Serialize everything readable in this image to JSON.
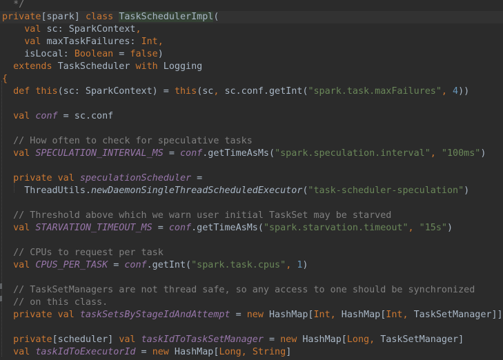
{
  "colors": {
    "background": "#2b2b2b",
    "current_line": "#323232",
    "keyword": "#cc7832",
    "default": "#a9b7c6",
    "string": "#6a8759",
    "comment": "#808080",
    "number": "#6897bb",
    "field": "#9876aa",
    "type_highlight": "#344134"
  },
  "editor": {
    "lines": [
      {
        "tokens": [
          {
            "t": "  */",
            "c": "comment"
          }
        ]
      },
      {
        "current": true,
        "tokens": [
          {
            "t": "private",
            "c": "keyword"
          },
          {
            "t": "[spark] ",
            "c": "default"
          },
          {
            "t": "class",
            "c": "keyword"
          },
          {
            "t": " ",
            "c": "default"
          },
          {
            "t": "TaskSchedulerImpl",
            "c": "default",
            "bg": true
          },
          {
            "t": "(",
            "c": "default"
          }
        ]
      },
      {
        "tokens": [
          {
            "t": "    ",
            "c": "default"
          },
          {
            "t": "val",
            "c": "keyword"
          },
          {
            "t": " sc: SparkContext",
            "c": "default"
          },
          {
            "t": ",",
            "c": "keyword"
          }
        ]
      },
      {
        "tokens": [
          {
            "t": "    ",
            "c": "default"
          },
          {
            "t": "val",
            "c": "keyword"
          },
          {
            "t": " maxTaskFailures: ",
            "c": "default"
          },
          {
            "t": "Int,",
            "c": "keyword"
          }
        ]
      },
      {
        "tokens": [
          {
            "t": "    isLocal: ",
            "c": "default"
          },
          {
            "t": "Boolean",
            "c": "keyword"
          },
          {
            "t": " = ",
            "c": "default"
          },
          {
            "t": "false",
            "c": "keyword"
          },
          {
            "t": ")",
            "c": "default"
          }
        ]
      },
      {
        "tokens": [
          {
            "t": "  ",
            "c": "default"
          },
          {
            "t": "extends",
            "c": "keyword"
          },
          {
            "t": " TaskScheduler ",
            "c": "default"
          },
          {
            "t": "with",
            "c": "keyword"
          },
          {
            "t": " Logging",
            "c": "default"
          }
        ]
      },
      {
        "tokens": [
          {
            "t": "{",
            "c": "keyword"
          }
        ]
      },
      {
        "tokens": [
          {
            "t": "  ",
            "c": "default"
          },
          {
            "t": "def",
            "c": "keyword"
          },
          {
            "t": " ",
            "c": "default"
          },
          {
            "t": "this",
            "c": "keyword"
          },
          {
            "t": "(sc: SparkContext) = ",
            "c": "default"
          },
          {
            "t": "this",
            "c": "keyword"
          },
          {
            "t": "(sc",
            "c": "default"
          },
          {
            "t": ",",
            "c": "keyword"
          },
          {
            "t": " sc.conf.getInt(",
            "c": "default"
          },
          {
            "t": "\"spark.task.maxFailures\"",
            "c": "string"
          },
          {
            "t": ", ",
            "c": "keyword"
          },
          {
            "t": "4",
            "c": "number"
          },
          {
            "t": "))",
            "c": "default"
          }
        ]
      },
      {
        "tokens": []
      },
      {
        "tokens": [
          {
            "t": "  ",
            "c": "default"
          },
          {
            "t": "val",
            "c": "keyword"
          },
          {
            "t": " ",
            "c": "default"
          },
          {
            "t": "conf",
            "c": "field",
            "i": true
          },
          {
            "t": " = sc.conf",
            "c": "default"
          }
        ]
      },
      {
        "tokens": []
      },
      {
        "tokens": [
          {
            "t": "  // How often to check for speculative tasks",
            "c": "comment"
          }
        ]
      },
      {
        "tokens": [
          {
            "t": "  ",
            "c": "default"
          },
          {
            "t": "val",
            "c": "keyword"
          },
          {
            "t": " ",
            "c": "default"
          },
          {
            "t": "SPECULATION_INTERVAL_MS",
            "c": "field",
            "i": true
          },
          {
            "t": " = ",
            "c": "default"
          },
          {
            "t": "conf",
            "c": "field",
            "i": true
          },
          {
            "t": ".getTimeAsMs(",
            "c": "default"
          },
          {
            "t": "\"spark.speculation.interval\"",
            "c": "string"
          },
          {
            "t": ", ",
            "c": "keyword"
          },
          {
            "t": "\"100ms\"",
            "c": "string"
          },
          {
            "t": ")",
            "c": "default"
          }
        ]
      },
      {
        "tokens": []
      },
      {
        "tokens": [
          {
            "t": "  ",
            "c": "default"
          },
          {
            "t": "private val",
            "c": "keyword"
          },
          {
            "t": " ",
            "c": "default"
          },
          {
            "t": "speculationScheduler",
            "c": "field",
            "i": true
          },
          {
            "t": " =",
            "c": "default"
          }
        ]
      },
      {
        "tokens": [
          {
            "t": "    ThreadUtils.",
            "c": "default"
          },
          {
            "t": "newDaemonSingleThreadScheduledExecutor",
            "c": "default",
            "i": true
          },
          {
            "t": "(",
            "c": "default"
          },
          {
            "t": "\"task-scheduler-speculation\"",
            "c": "string"
          },
          {
            "t": ")",
            "c": "default"
          }
        ]
      },
      {
        "tokens": []
      },
      {
        "tokens": [
          {
            "t": "  // Threshold above which we warn user initial TaskSet may be starved",
            "c": "comment"
          }
        ]
      },
      {
        "tokens": [
          {
            "t": "  ",
            "c": "default"
          },
          {
            "t": "val",
            "c": "keyword"
          },
          {
            "t": " ",
            "c": "default"
          },
          {
            "t": "STARVATION_TIMEOUT_MS",
            "c": "field",
            "i": true
          },
          {
            "t": " = ",
            "c": "default"
          },
          {
            "t": "conf",
            "c": "field",
            "i": true
          },
          {
            "t": ".getTimeAsMs(",
            "c": "default"
          },
          {
            "t": "\"spark.starvation.timeout\"",
            "c": "string"
          },
          {
            "t": ", ",
            "c": "keyword"
          },
          {
            "t": "\"15s\"",
            "c": "string"
          },
          {
            "t": ")",
            "c": "default"
          }
        ]
      },
      {
        "tokens": []
      },
      {
        "tokens": [
          {
            "t": "  // CPUs to request per task",
            "c": "comment"
          }
        ]
      },
      {
        "tokens": [
          {
            "t": "  ",
            "c": "default"
          },
          {
            "t": "val",
            "c": "keyword"
          },
          {
            "t": " ",
            "c": "default"
          },
          {
            "t": "CPUS_PER_TASK",
            "c": "field",
            "i": true
          },
          {
            "t": " = ",
            "c": "default"
          },
          {
            "t": "conf",
            "c": "field",
            "i": true
          },
          {
            "t": ".getInt(",
            "c": "default"
          },
          {
            "t": "\"spark.task.cpus\"",
            "c": "string"
          },
          {
            "t": ", ",
            "c": "keyword"
          },
          {
            "t": "1",
            "c": "number"
          },
          {
            "t": ")",
            "c": "default"
          }
        ]
      },
      {
        "tokens": []
      },
      {
        "tokens": [
          {
            "t": "  // TaskSetManagers are not thread safe, so any access to one should be synchronized",
            "c": "comment"
          }
        ]
      },
      {
        "tokens": [
          {
            "t": "  // on this class.",
            "c": "comment"
          }
        ]
      },
      {
        "tokens": [
          {
            "t": "  ",
            "c": "default"
          },
          {
            "t": "private val",
            "c": "keyword"
          },
          {
            "t": " ",
            "c": "default"
          },
          {
            "t": "taskSetsByStageIdAndAttempt",
            "c": "field",
            "i": true
          },
          {
            "t": " = ",
            "c": "default"
          },
          {
            "t": "new",
            "c": "keyword"
          },
          {
            "t": " HashMap[",
            "c": "default"
          },
          {
            "t": "Int,",
            "c": "keyword"
          },
          {
            "t": " HashMap[",
            "c": "default"
          },
          {
            "t": "Int,",
            "c": "keyword"
          },
          {
            "t": " TaskSetManager]]",
            "c": "default"
          }
        ]
      },
      {
        "tokens": []
      },
      {
        "tokens": [
          {
            "t": "  ",
            "c": "default"
          },
          {
            "t": "private",
            "c": "keyword"
          },
          {
            "t": "[scheduler] ",
            "c": "default"
          },
          {
            "t": "val",
            "c": "keyword"
          },
          {
            "t": " ",
            "c": "default"
          },
          {
            "t": "taskIdToTaskSetManager",
            "c": "field",
            "i": true
          },
          {
            "t": " = ",
            "c": "default"
          },
          {
            "t": "new",
            "c": "keyword"
          },
          {
            "t": " HashMap[",
            "c": "default"
          },
          {
            "t": "Long,",
            "c": "keyword"
          },
          {
            "t": " TaskSetManager]",
            "c": "default"
          }
        ]
      },
      {
        "tokens": [
          {
            "t": "  ",
            "c": "default"
          },
          {
            "t": "val",
            "c": "keyword"
          },
          {
            "t": " ",
            "c": "default"
          },
          {
            "t": "taskIdToExecutorId",
            "c": "field",
            "i": true
          },
          {
            "t": " = ",
            "c": "default"
          },
          {
            "t": "new",
            "c": "keyword"
          },
          {
            "t": " HashMap[",
            "c": "default"
          },
          {
            "t": "Long,",
            "c": "keyword"
          },
          {
            "t": " ",
            "c": "default"
          },
          {
            "t": "String",
            "c": "keyword"
          },
          {
            "t": "]",
            "c": "default"
          }
        ]
      }
    ]
  }
}
